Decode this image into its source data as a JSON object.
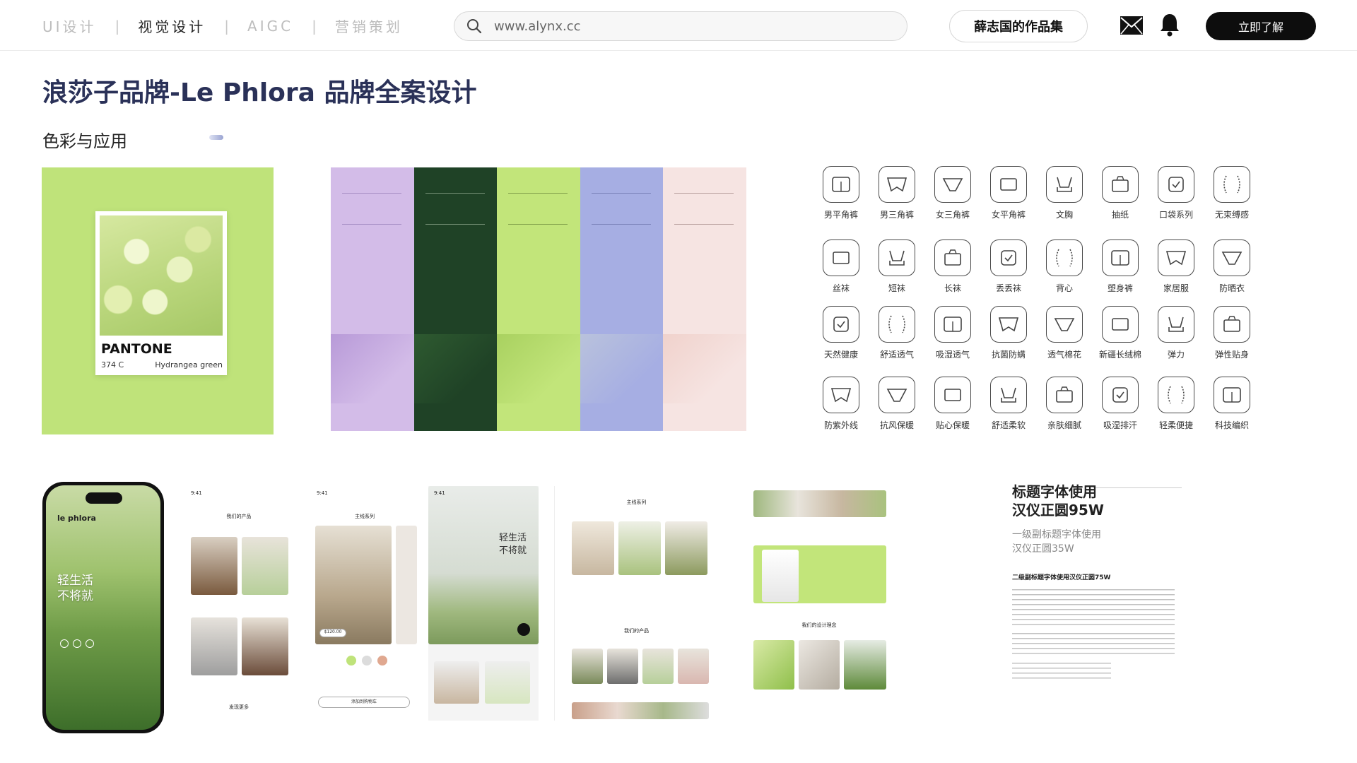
{
  "nav": {
    "items": [
      {
        "label": "UI设计",
        "active": false
      },
      {
        "label": "视觉设计",
        "active": true
      },
      {
        "label": "AIGC",
        "active": false
      },
      {
        "label": "营销策划",
        "active": false
      }
    ],
    "separator": "|"
  },
  "search": {
    "value": "www.alynx.cc"
  },
  "header": {
    "portfolio_label": "薛志国的作品集",
    "cta_label": "立即了解"
  },
  "page": {
    "title": "浪莎子品牌-Le Phlora 品牌全案设计",
    "section_title": "色彩与应用"
  },
  "pantone": {
    "name": "PANTONE",
    "code": "374 C",
    "color_name": "Hydrangea green",
    "bg_color": "#bfe37a"
  },
  "palette": {
    "colors": [
      {
        "top": "#d3bce8",
        "image": "#b89ad8",
        "bottom": "#d3bce8",
        "text": "#7a5fa0"
      },
      {
        "top": "#1f4226",
        "image": "#2e5a30",
        "bottom": "#1f4226",
        "text": "#cfe0c8"
      },
      {
        "top": "#c2e57a",
        "image": "#a9d160",
        "bottom": "#c2e57a",
        "text": "#3d5a1a"
      },
      {
        "top": "#a6aee3",
        "image": "#b9c2dc",
        "bottom": "#a6aee3",
        "text": "#4e5690"
      },
      {
        "top": "#f6e4e2",
        "image": "#f0d2cc",
        "bottom": "#f6e4e2",
        "text": "#7a5a58"
      }
    ]
  },
  "icons": {
    "rows": [
      [
        "男平角裤",
        "男三角裤",
        "女三角裤",
        "女平角裤",
        "文胸",
        "抽纸",
        "口袋系列",
        "无束缚感"
      ],
      [
        "丝袜",
        "短袜",
        "长袜",
        "丢丢袜",
        "背心",
        "塑身裤",
        "家居服",
        "防晒衣"
      ],
      [
        "天然健康",
        "舒适透气",
        "吸湿透气",
        "抗菌防螨",
        "透气棉花",
        "新疆长绒棉",
        "弹力",
        "弹性贴身"
      ],
      [
        "防紫外线",
        "抗风保暖",
        "贴心保暖",
        "舒适柔软",
        "亲肤细腻",
        "吸湿排汗",
        "轻柔便捷",
        "科技编织"
      ]
    ]
  },
  "mockups": {
    "phone_brand": "le phlora",
    "phone_slogan_1": "轻生活",
    "phone_slogan_2": "不将就",
    "time": "9:41",
    "products_title": "我们的产品",
    "series_title": "主线系列",
    "price": "$120.00",
    "add_to_cart": "添加到购物车",
    "hero_slogan_1": "轻生活",
    "hero_slogan_2": "不将就",
    "more": "发现更多",
    "design_concept": "我们的设计理念"
  },
  "typography": {
    "title_line1": "标题字体使用",
    "title_line2": "汉仪正圆95W",
    "sub_line1": "一级副标题字体使用",
    "sub_line2": "汉仪正圆35W",
    "h3": "二级副标题字体使用汉仪正圆75W"
  }
}
